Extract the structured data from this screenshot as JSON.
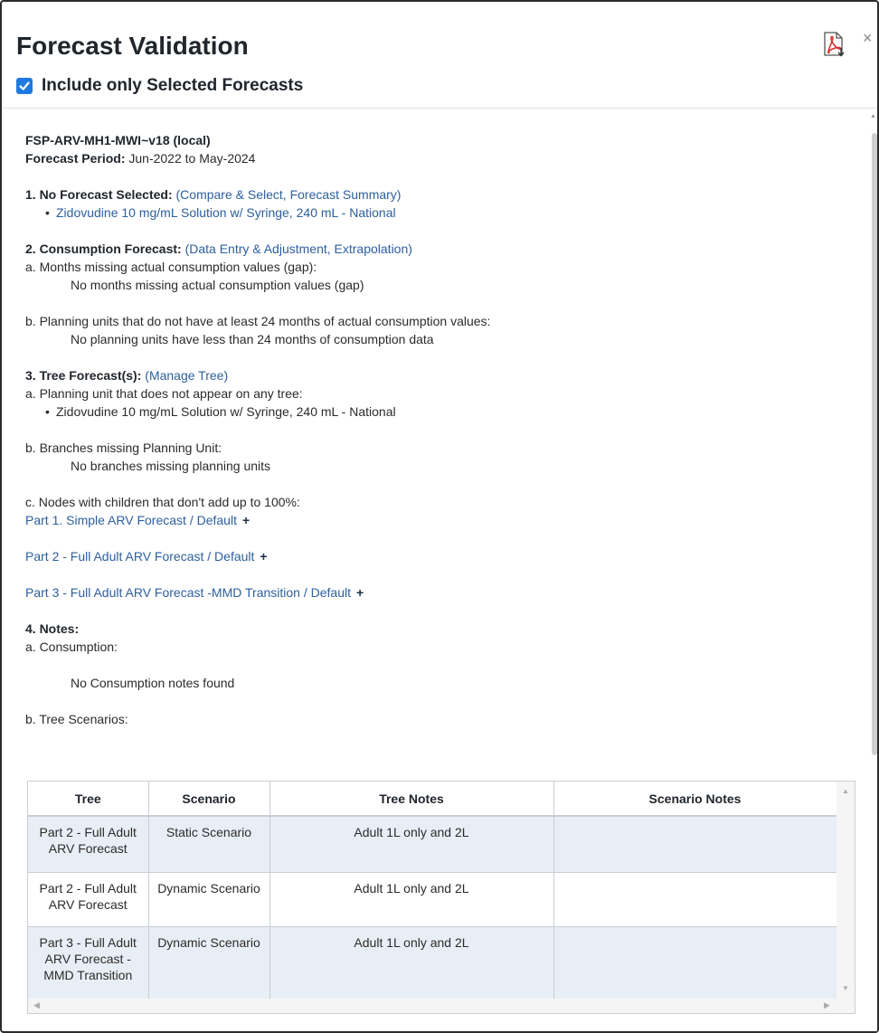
{
  "header": {
    "title": "Forecast Validation",
    "include_label": "Include only Selected Forecasts",
    "include_checked": true,
    "close_symbol": "×",
    "pdf_icon": "pdf-export-icon"
  },
  "forecast": {
    "name": "FSP-ARV-MH1-MWI~v18 (local)",
    "period_label": "Forecast Period:",
    "period_value": "Jun-2022 to May-2024"
  },
  "section1": {
    "heading": "1. No Forecast Selected:",
    "links": [
      "(Compare & Select, Forecast Summary)"
    ],
    "items": [
      "Zidovudine 10 mg/mL Solution w/ Syringe, 240 mL - National"
    ]
  },
  "section2": {
    "heading": "2. Consumption Forecast:",
    "link": "(Data Entry & Adjustment, Extrapolation)",
    "a_label": "a. Months missing actual consumption values (gap):",
    "a_value": "No months missing actual consumption values (gap)",
    "b_label": "b. Planning units that do not have at least 24 months of actual consumption values:",
    "b_value": "No planning units have less than 24 months of consumption data"
  },
  "section3": {
    "heading": "3. Tree Forecast(s):",
    "link": "(Manage Tree)",
    "a_label": "a. Planning unit that does not appear on any tree:",
    "a_items": [
      "Zidovudine 10 mg/mL Solution w/ Syringe, 240 mL - National"
    ],
    "b_label": "b. Branches missing Planning Unit:",
    "b_value": "No branches missing planning units",
    "c_label": "c. Nodes with children that don't add up to 100%:",
    "trees": [
      "Part 1. Simple ARV Forecast / Default",
      "Part 2 - Full Adult ARV Forecast / Default",
      "Part 3 - Full Adult ARV Forecast -MMD Transition / Default"
    ],
    "expand_symbol": "+"
  },
  "section4": {
    "heading": "4. Notes:",
    "a_label": "a. Consumption:",
    "a_value": "No Consumption notes found",
    "b_label": "b. Tree Scenarios:"
  },
  "notes_table": {
    "columns": [
      "Tree",
      "Scenario",
      "Tree Notes",
      "Scenario Notes"
    ],
    "rows": [
      {
        "tree": "Part 2 - Full Adult ARV Forecast",
        "scenario": "Static Scenario",
        "tree_notes": "Adult 1L only and 2L",
        "scenario_notes": ""
      },
      {
        "tree": "Part 2 - Full Adult ARV Forecast",
        "scenario": "Dynamic Scenario",
        "tree_notes": "Adult 1L only and 2L",
        "scenario_notes": ""
      },
      {
        "tree": "Part 3 - Full Adult ARV Forecast - MMD Transition",
        "scenario": "Dynamic Scenario",
        "tree_notes": "Adult 1L only and 2L",
        "scenario_notes": ""
      }
    ]
  },
  "colors": {
    "link": "#2c5f9e",
    "checkbox": "#1f7ae0",
    "row_alt": "#e8eef5",
    "pdf_red": "#d9302c"
  }
}
